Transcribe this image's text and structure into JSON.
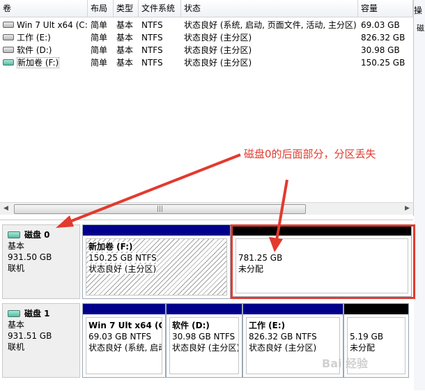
{
  "columns": [
    "卷",
    "布局",
    "类型",
    "文件系统",
    "状态",
    "容量"
  ],
  "volumes": [
    {
      "name": "Win 7 Ult x64 (C:)",
      "layout": "简单",
      "type": "基本",
      "fs": "NTFS",
      "status": "状态良好 (系统, 启动, 页面文件, 活动, 主分区)",
      "capacity": "69.03 GB",
      "icon": "disk-icon"
    },
    {
      "name": "工作 (E:)",
      "layout": "简单",
      "type": "基本",
      "fs": "NTFS",
      "status": "状态良好 (主分区)",
      "capacity": "826.32 GB",
      "icon": "disk-icon"
    },
    {
      "name": "软件 (D:)",
      "layout": "简单",
      "type": "基本",
      "fs": "NTFS",
      "status": "状态良好 (主分区)",
      "capacity": "30.98 GB",
      "icon": "disk-icon"
    },
    {
      "name": "新加卷 (F:)",
      "layout": "简单",
      "type": "基本",
      "fs": "NTFS",
      "status": "状态良好 (主分区)",
      "capacity": "150.25 GB",
      "icon": "disk-icon-highlighted"
    }
  ],
  "action_pane": {
    "header": "操",
    "item": "磁"
  },
  "annotation": "磁盘0的后面部分，分区丢失",
  "disks": [
    {
      "name": "磁盘 0",
      "type": "基本",
      "size": "931.50 GB",
      "state": "联机",
      "partitions": [
        {
          "name": "新加卷  (F:)",
          "detail": "150.25 GB NTFS",
          "status": "状态良好 (主分区)",
          "bar_color": "#00008b",
          "hatched": true
        },
        {
          "name": "",
          "detail": "781.25 GB",
          "status": "未分配",
          "bar_color": "#000000",
          "hatched": false
        }
      ]
    },
    {
      "name": "磁盘 1",
      "type": "基本",
      "size": "931.51 GB",
      "state": "联机",
      "partitions": [
        {
          "name": "Win 7 Ult x64  (C",
          "detail": "69.03 GB NTFS",
          "status": "状态良好 (系统, 启动",
          "bar_color": "#00008b"
        },
        {
          "name": "软件  (D:)",
          "detail": "30.98 GB NTFS",
          "status": "状态良好 (主分区)",
          "bar_color": "#00008b"
        },
        {
          "name": "工作  (E:)",
          "detail": "826.32 GB NTFS",
          "status": "状态良好 (主分区)",
          "bar_color": "#00008b"
        },
        {
          "name": "",
          "detail": "5.19 GB",
          "status": "未分配",
          "bar_color": "#000000"
        }
      ]
    }
  ],
  "watermark": "Bai 经验",
  "colors": {
    "primary_partition": "#00008b",
    "unallocated": "#000000",
    "annotation": "#e23a2e"
  }
}
